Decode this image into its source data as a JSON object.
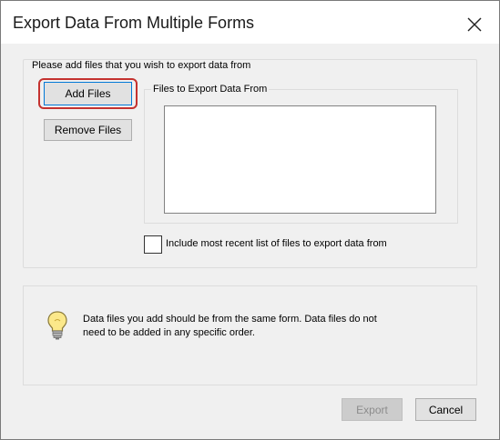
{
  "dialog": {
    "title": "Export Data From Multiple Forms",
    "close_icon": "close-icon"
  },
  "files_group": {
    "label": "Please add files that you wish to export data from",
    "add_button": "Add Files",
    "remove_button": "Remove Files",
    "list_label": "Files to Export Data From",
    "files": []
  },
  "recent_checkbox": {
    "label": "Include most recent list of files to export data from",
    "checked": false
  },
  "info": {
    "icon": "lightbulb-icon",
    "text_line1": "Data files you add should be from the same form. Data files do not",
    "text_line2": "need to be added in any specific order."
  },
  "footer": {
    "export_button": "Export",
    "cancel_button": "Cancel"
  },
  "colors": {
    "highlight": "#c4322f",
    "primary_border": "#0078d7"
  }
}
